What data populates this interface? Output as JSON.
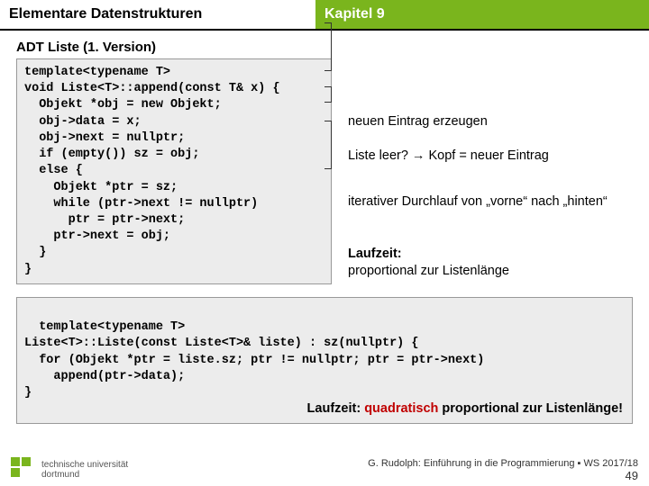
{
  "header": {
    "left": "Elementare Datenstrukturen",
    "right": "Kapitel 9"
  },
  "subtitle": "ADT Liste (1. Version)",
  "code1": "template<typename T>\nvoid Liste<T>::append(const T& x) {\n  Objekt *obj = new Objekt;\n  obj->data = x;\n  obj->next = nullptr;\n  if (empty()) sz = obj;\n  else {\n    Objekt *ptr = sz;\n    while (ptr->next != nullptr)\n      ptr = ptr->next;\n    ptr->next = obj;\n  }\n}",
  "annotations": {
    "a1": "neuen Eintrag erzeugen",
    "a2": "Liste leer? → Kopf = neuer Eintrag",
    "a3": "iterativer Durchlauf von „vorne“ nach „hinten“",
    "a4_label": "Laufzeit:",
    "a4_text": "proportional zur Listenlänge"
  },
  "code2": "template<typename T>\nListe<T>::Liste(const Liste<T>& liste) : sz(nullptr) {\n  for (Objekt *ptr = liste.sz; ptr != nullptr; ptr = ptr->next)\n    append(ptr->data);\n}",
  "runtime2": {
    "label": "Laufzeit: ",
    "highlight": "quadratisch",
    "rest": " proportional zur Listenlänge!"
  },
  "footer": {
    "logo_line1": "technische universität",
    "logo_line2": "dortmund",
    "credit": "G. Rudolph: Einführung in die Programmierung ▪ WS 2017/18",
    "page": "49"
  }
}
